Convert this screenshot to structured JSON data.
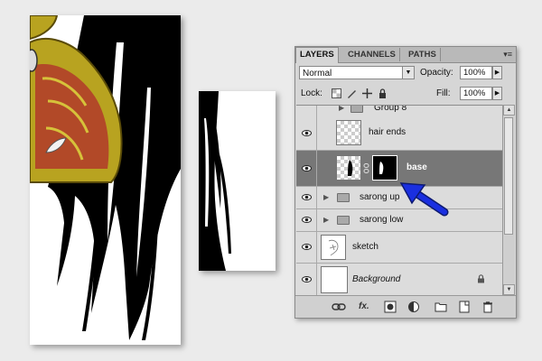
{
  "panel": {
    "tabs": [
      {
        "label": "LAYERS",
        "active": true
      },
      {
        "label": "CHANNELS",
        "active": false
      },
      {
        "label": "PATHS",
        "active": false
      }
    ],
    "menu_glyph": "▾≡",
    "blend_mode": "Normal",
    "opacity_label": "Opacity:",
    "opacity_value": "100%",
    "lock_label": "Lock:",
    "fill_label": "Fill:",
    "fill_value": "100%"
  },
  "layers": [
    {
      "name": "Group 8",
      "kind": "group",
      "visible": false,
      "selected": false
    },
    {
      "name": "hair ends",
      "kind": "layer",
      "visible": true,
      "selected": false
    },
    {
      "name": "base",
      "kind": "masked-layer",
      "visible": true,
      "selected": true
    },
    {
      "name": "sarong up",
      "kind": "group",
      "visible": true,
      "selected": false
    },
    {
      "name": "sarong low",
      "kind": "group",
      "visible": true,
      "selected": false
    },
    {
      "name": "sketch",
      "kind": "layer",
      "visible": true,
      "selected": false
    },
    {
      "name": "Background",
      "kind": "background",
      "visible": true,
      "selected": false,
      "locked": true
    }
  ],
  "colors": {
    "selected_row": "#777777",
    "annotation_arrow": "#1a2fe0",
    "gold": "#b8a320",
    "red_pattern": "#b03a2a"
  }
}
